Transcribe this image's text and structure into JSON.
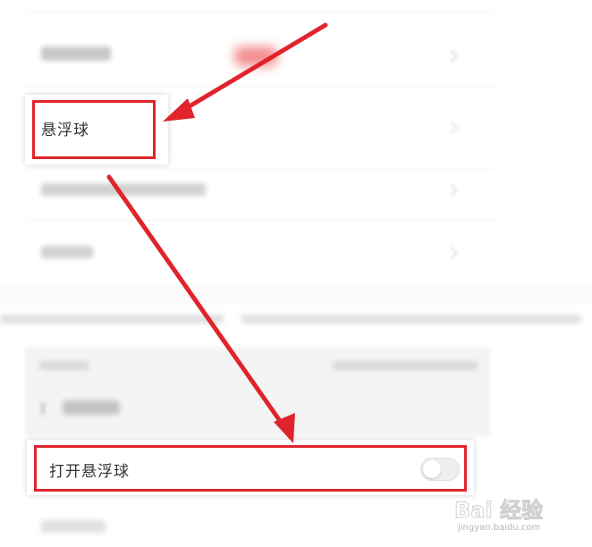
{
  "settings": {
    "float_ball_label": "悬浮球",
    "open_float_ball_label": "打开悬浮球",
    "open_float_ball_enabled": false
  },
  "annotation": {
    "highlight_color": "#e1232b"
  },
  "watermark": {
    "brand": "Bai 经验",
    "url": "jingyan.baidu.com"
  }
}
